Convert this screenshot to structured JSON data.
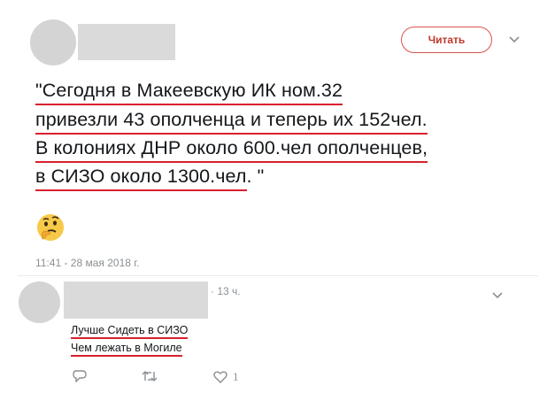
{
  "tweet": {
    "follow_label": "Читать",
    "lines": [
      "\"Сегодня в Макеевскую ИК ном.32",
      "привезли 43 ополченца и теперь их 152чел.",
      "В колониях ДНР около 600.чел ополченцев,",
      "в СИЗО около 1300.чел"
    ],
    "line4_tail": ". \"",
    "emoji": "🤔",
    "timestamp": "11:41 - 28 мая 2018 г."
  },
  "reply": {
    "time": "· 13 ч.",
    "lines": [
      "Лучше Сидеть в СИЗО",
      "Чем лежать в Могиле"
    ],
    "like_count": "1"
  },
  "colors": {
    "accent_red": "#d8202e",
    "meta_gray": "#8a8f94",
    "redaction_gray": "#dadada"
  }
}
